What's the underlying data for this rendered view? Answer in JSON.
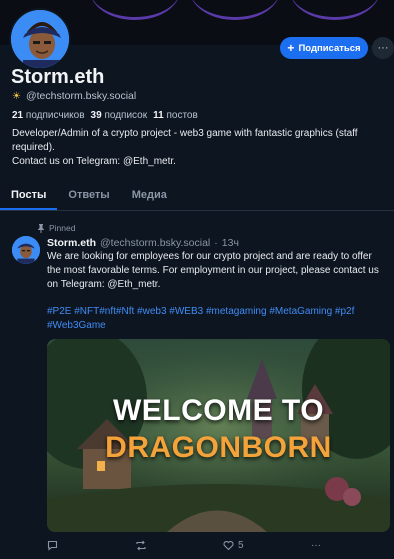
{
  "profile": {
    "display_name": "Storm.eth",
    "handle": "@techstorm.bsky.social",
    "followers_count": "21",
    "followers_label": "подписчиков",
    "following_count": "39",
    "following_label": "подписок",
    "posts_count": "11",
    "posts_label": "постов",
    "bio_line1": "Developer/Admin of a crypto project - web3 game with fantastic graphics (staff required).",
    "bio_line2": "Contact us on Telegram: @Eth_metr.",
    "follow_label": "Подписаться",
    "more_label": "···"
  },
  "tabs": [
    {
      "label": "Посты",
      "active": true
    },
    {
      "label": "Ответы",
      "active": false
    },
    {
      "label": "Медиа",
      "active": false
    }
  ],
  "post": {
    "pinned_label": "Pinned",
    "author_name": "Storm.eth",
    "author_handle": "@techstorm.bsky.social",
    "separator": "·",
    "time": "13ч",
    "text": "We are looking for employees for our crypto project and are ready to offer the most favorable terms. For employment in our project, please contact us on Telegram: @Eth_metr.",
    "tags": "#P2E #NFT#nft#Nft #web3 #WEB3 #metagaming #MetaGaming #p2f #Web3Game",
    "image_title_line1": "WELCOME TO",
    "image_title_line2": "DRAGONBORN",
    "like_count": "5"
  },
  "colors": {
    "background": "#0d1520",
    "accent": "#1d6ff2",
    "link": "#3f8cf5",
    "image_accent": "#f4a23a"
  }
}
